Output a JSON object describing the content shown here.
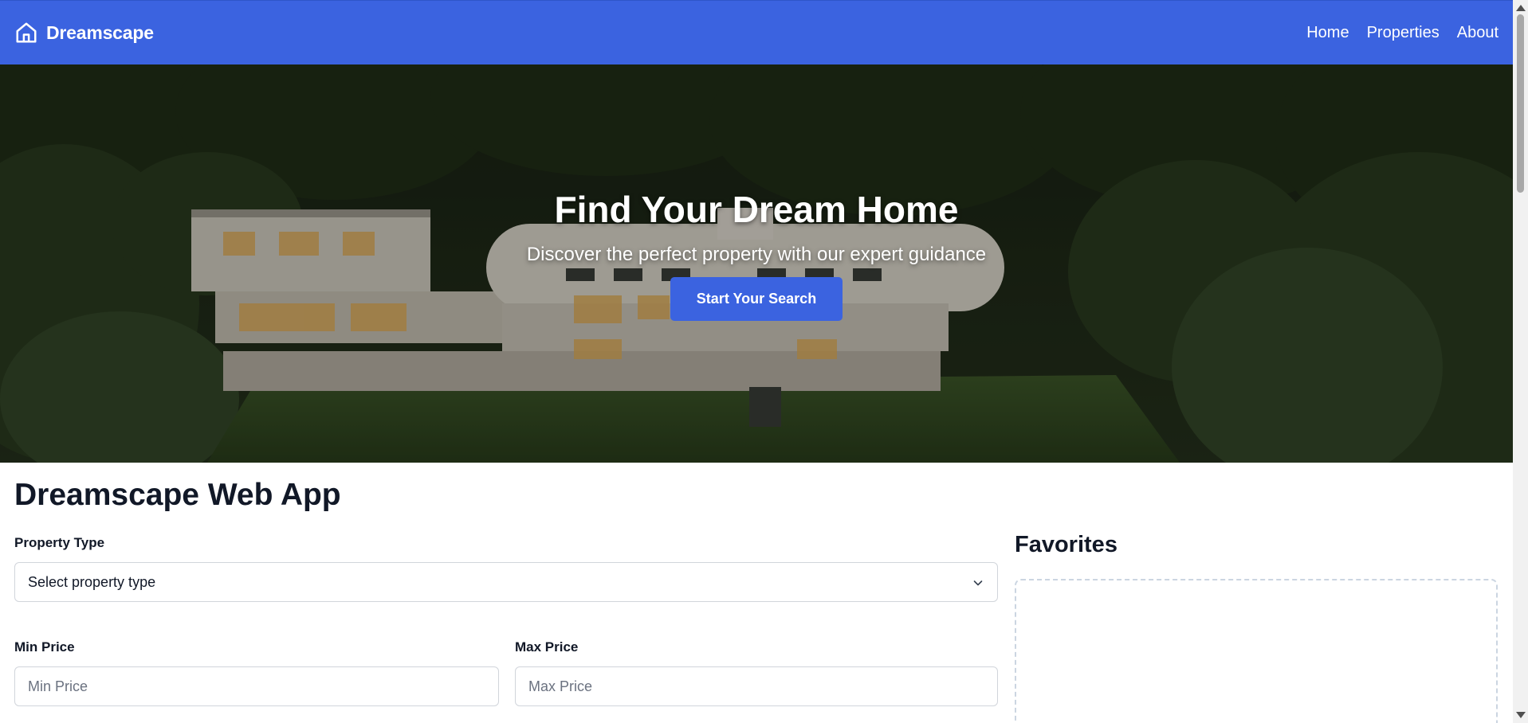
{
  "nav": {
    "brand": "Dreamscape",
    "links": [
      "Home",
      "Properties",
      "About"
    ]
  },
  "hero": {
    "title": "Find Your Dream Home",
    "subtitle": "Discover the perfect property with our expert guidance",
    "cta": "Start Your Search"
  },
  "main": {
    "title": "Dreamscape Web App",
    "property_type": {
      "label": "Property Type",
      "selected": "Select property type"
    },
    "min_price": {
      "label": "Min Price",
      "placeholder": "Min Price"
    },
    "max_price": {
      "label": "Max Price",
      "placeholder": "Max Price"
    }
  },
  "favorites": {
    "title": "Favorites"
  },
  "colors": {
    "primary": "#3b63e0",
    "text": "#111827",
    "border": "#d1d5db",
    "dashed_border": "#cbd5e1"
  },
  "icons": {
    "brand": "home-icon",
    "select": "chevron-down-icon"
  }
}
